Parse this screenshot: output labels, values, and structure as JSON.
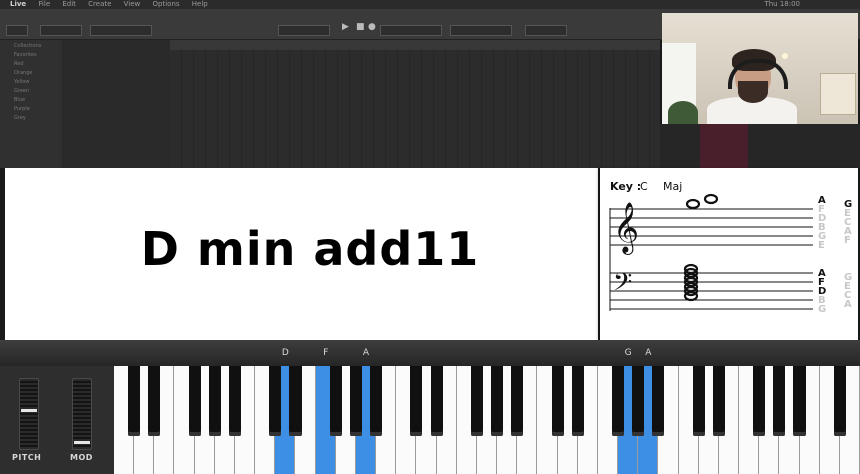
{
  "daw": {
    "menu": [
      "Live",
      "File",
      "Edit",
      "Create",
      "View",
      "Options",
      "Help"
    ],
    "clock": "Thu 18:00",
    "sidebar": [
      "Collections",
      "Favorites",
      "Red",
      "Orange",
      "Yellow",
      "Green",
      "Blue",
      "Purple",
      "Grey"
    ]
  },
  "chord": {
    "name": "D min add11"
  },
  "notation": {
    "key_label": "Key :",
    "key_root": "C",
    "key_quality": "Maj",
    "treble_letters_left": [
      "A",
      "F",
      "D",
      "B",
      "G",
      "E"
    ],
    "treble_letters_right": [
      "G",
      "E",
      "C",
      "A",
      "F"
    ],
    "bass_letters_left": [
      "A",
      "F",
      "D",
      "B",
      "G"
    ],
    "bass_letters_right": [
      "G",
      "E",
      "C",
      "A"
    ],
    "active_letter_color": "#111111",
    "inactive_letter_color": "#c8c8c8"
  },
  "keyboard": {
    "highlight_color": "#3d8fe6",
    "note_labels": [
      {
        "label": "D",
        "white_index": 8
      },
      {
        "label": "F",
        "white_index": 10
      },
      {
        "label": "A",
        "white_index": 12
      },
      {
        "label": "G",
        "white_index": 25
      },
      {
        "label": "A",
        "white_index": 26
      }
    ],
    "pressed_white_keys": [
      8,
      10,
      12,
      25,
      26
    ],
    "white_key_count": 37,
    "first_white_note": "C"
  },
  "controls": {
    "pitch_label": "PITCH",
    "mod_label": "MOD"
  }
}
